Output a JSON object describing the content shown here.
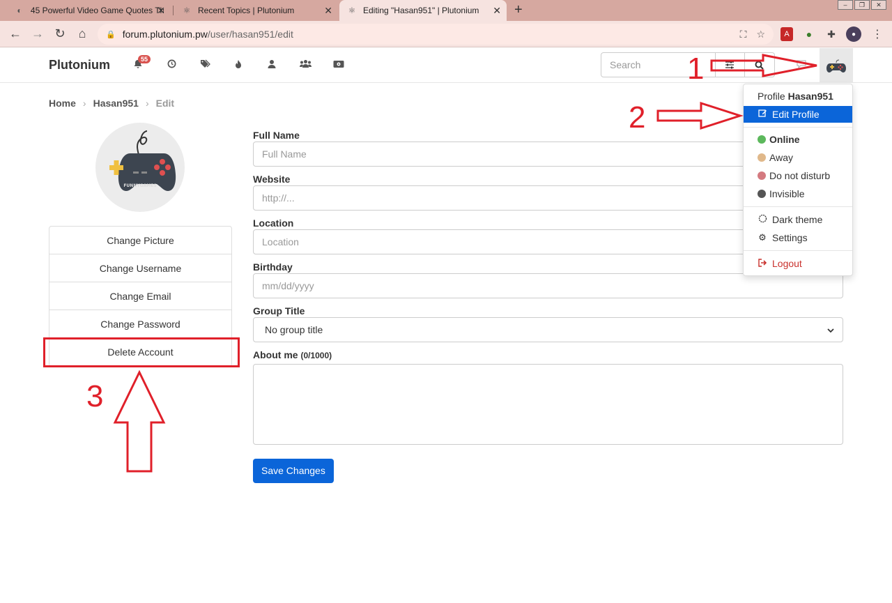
{
  "browser": {
    "tabs": [
      {
        "title": "45 Powerful Video Game Quotes Th",
        "close": "✕"
      },
      {
        "title": "Recent Topics | Plutonium",
        "close": "✕"
      },
      {
        "title": "Editing \"Hasan951\" | Plutonium",
        "close": "✕"
      }
    ],
    "new_tab": "+",
    "url_host": "forum.plutonium.pw",
    "url_path": "/user/hasan951/edit"
  },
  "header": {
    "brand": "Plutonium",
    "notifications_count": "55",
    "search_placeholder": "Search"
  },
  "breadcrumb": {
    "home": "Home",
    "user": "Hasan951",
    "current": "Edit"
  },
  "avatar": {
    "caption": "FUNNYGAMES"
  },
  "side_menu": [
    "Change Picture",
    "Change Username",
    "Change Email",
    "Change Password",
    "Delete Account"
  ],
  "form": {
    "full_name": {
      "label": "Full Name",
      "placeholder": "Full Name"
    },
    "website": {
      "label": "Website",
      "placeholder": "http://..."
    },
    "location": {
      "label": "Location",
      "placeholder": "Location"
    },
    "birthday": {
      "label": "Birthday",
      "placeholder": "mm/dd/yyyy"
    },
    "group_title": {
      "label": "Group Title",
      "value": "No group title"
    },
    "about_me": {
      "label": "About me",
      "counter": "(0/1000)"
    },
    "save_label": "Save Changes"
  },
  "dropdown": {
    "profile_prefix": "Profile",
    "profile_name": "Hasan951",
    "edit_profile": "Edit Profile",
    "statuses": [
      {
        "label": "Online",
        "color": "#5cb85c"
      },
      {
        "label": "Away",
        "color": "#e0b060"
      },
      {
        "label": "Do not disturb",
        "color": "#d9534f"
      },
      {
        "label": "Invisible",
        "color": "#555555"
      }
    ],
    "dark_theme": "Dark theme",
    "settings": "Settings",
    "logout": "Logout"
  },
  "annotations": {
    "step1": "1",
    "step2": "2",
    "step3": "3",
    "color": "#e0202a"
  }
}
